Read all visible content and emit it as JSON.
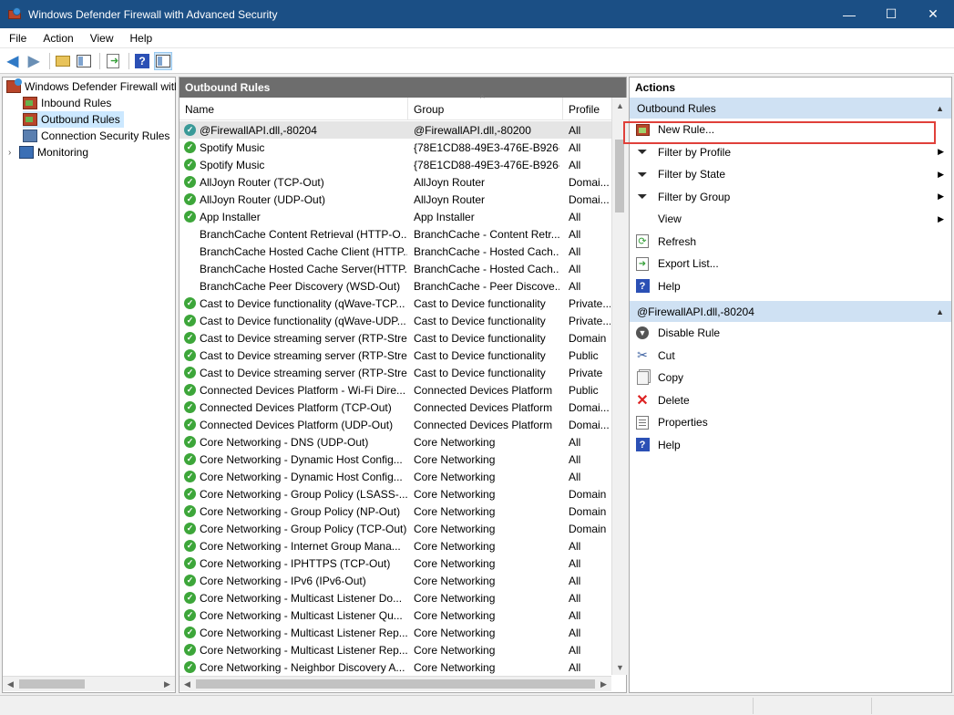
{
  "window": {
    "title": "Windows Defender Firewall with Advanced Security",
    "minimize": "—",
    "maximize": "☐",
    "close": "✕"
  },
  "menu": [
    "File",
    "Action",
    "View",
    "Help"
  ],
  "toolbar": {
    "icons": [
      "back-icon",
      "forward-icon",
      "up-folder-icon",
      "show-hide-console-tree-icon",
      "export-list-icon",
      "help-icon",
      "show-hide-action-pane-icon"
    ]
  },
  "tree": {
    "root": "Windows Defender Firewall witl",
    "items": [
      {
        "label": "Inbound Rules"
      },
      {
        "label": "Outbound Rules"
      },
      {
        "label": "Connection Security Rules"
      },
      {
        "label": "Monitoring"
      }
    ]
  },
  "center": {
    "header": "Outbound Rules",
    "columns": {
      "name": "Name",
      "group": "Group",
      "profile": "Profile"
    },
    "rows": [
      {
        "name": "@FirewallAPI.dll,-80204",
        "group": "@FirewallAPI.dll,-80200",
        "profile": "All",
        "enabled": true,
        "icon": "globe"
      },
      {
        "name": "Spotify Music",
        "group": "{78E1CD88-49E3-476E-B926-...",
        "profile": "All",
        "enabled": true
      },
      {
        "name": "Spotify Music",
        "group": "{78E1CD88-49E3-476E-B926-...",
        "profile": "All",
        "enabled": true
      },
      {
        "name": "AllJoyn Router (TCP-Out)",
        "group": "AllJoyn Router",
        "profile": "Domai...",
        "enabled": true
      },
      {
        "name": "AllJoyn Router (UDP-Out)",
        "group": "AllJoyn Router",
        "profile": "Domai...",
        "enabled": true
      },
      {
        "name": "App Installer",
        "group": "App Installer",
        "profile": "All",
        "enabled": true
      },
      {
        "name": "BranchCache Content Retrieval (HTTP-O...",
        "group": "BranchCache - Content Retr...",
        "profile": "All",
        "enabled": false
      },
      {
        "name": "BranchCache Hosted Cache Client (HTTP...",
        "group": "BranchCache - Hosted Cach...",
        "profile": "All",
        "enabled": false
      },
      {
        "name": "BranchCache Hosted Cache Server(HTTP...",
        "group": "BranchCache - Hosted Cach...",
        "profile": "All",
        "enabled": false
      },
      {
        "name": "BranchCache Peer Discovery (WSD-Out)",
        "group": "BranchCache - Peer Discove...",
        "profile": "All",
        "enabled": false
      },
      {
        "name": "Cast to Device functionality (qWave-TCP...",
        "group": "Cast to Device functionality",
        "profile": "Private...",
        "enabled": true
      },
      {
        "name": "Cast to Device functionality (qWave-UDP...",
        "group": "Cast to Device functionality",
        "profile": "Private...",
        "enabled": true
      },
      {
        "name": "Cast to Device streaming server (RTP-Stre...",
        "group": "Cast to Device functionality",
        "profile": "Domain",
        "enabled": true
      },
      {
        "name": "Cast to Device streaming server (RTP-Stre...",
        "group": "Cast to Device functionality",
        "profile": "Public",
        "enabled": true
      },
      {
        "name": "Cast to Device streaming server (RTP-Stre...",
        "group": "Cast to Device functionality",
        "profile": "Private",
        "enabled": true
      },
      {
        "name": "Connected Devices Platform - Wi-Fi Dire...",
        "group": "Connected Devices Platform",
        "profile": "Public",
        "enabled": true
      },
      {
        "name": "Connected Devices Platform (TCP-Out)",
        "group": "Connected Devices Platform",
        "profile": "Domai...",
        "enabled": true
      },
      {
        "name": "Connected Devices Platform (UDP-Out)",
        "group": "Connected Devices Platform",
        "profile": "Domai...",
        "enabled": true
      },
      {
        "name": "Core Networking - DNS (UDP-Out)",
        "group": "Core Networking",
        "profile": "All",
        "enabled": true
      },
      {
        "name": "Core Networking - Dynamic Host Config...",
        "group": "Core Networking",
        "profile": "All",
        "enabled": true
      },
      {
        "name": "Core Networking - Dynamic Host Config...",
        "group": "Core Networking",
        "profile": "All",
        "enabled": true
      },
      {
        "name": "Core Networking - Group Policy (LSASS-...",
        "group": "Core Networking",
        "profile": "Domain",
        "enabled": true
      },
      {
        "name": "Core Networking - Group Policy (NP-Out)",
        "group": "Core Networking",
        "profile": "Domain",
        "enabled": true
      },
      {
        "name": "Core Networking - Group Policy (TCP-Out)",
        "group": "Core Networking",
        "profile": "Domain",
        "enabled": true
      },
      {
        "name": "Core Networking - Internet Group Mana...",
        "group": "Core Networking",
        "profile": "All",
        "enabled": true
      },
      {
        "name": "Core Networking - IPHTTPS (TCP-Out)",
        "group": "Core Networking",
        "profile": "All",
        "enabled": true
      },
      {
        "name": "Core Networking - IPv6 (IPv6-Out)",
        "group": "Core Networking",
        "profile": "All",
        "enabled": true
      },
      {
        "name": "Core Networking - Multicast Listener Do...",
        "group": "Core Networking",
        "profile": "All",
        "enabled": true
      },
      {
        "name": "Core Networking - Multicast Listener Qu...",
        "group": "Core Networking",
        "profile": "All",
        "enabled": true
      },
      {
        "name": "Core Networking - Multicast Listener Rep...",
        "group": "Core Networking",
        "profile": "All",
        "enabled": true
      },
      {
        "name": "Core Networking - Multicast Listener Rep...",
        "group": "Core Networking",
        "profile": "All",
        "enabled": true
      },
      {
        "name": "Core Networking - Neighbor Discovery A...",
        "group": "Core Networking",
        "profile": "All",
        "enabled": true
      }
    ]
  },
  "actions": {
    "title": "Actions",
    "section1": {
      "label": "Outbound Rules",
      "items": [
        {
          "label": "New Rule...",
          "icon": "new-rule-icon",
          "submenu": false
        },
        {
          "label": "Filter by Profile",
          "icon": "filter-icon",
          "submenu": true
        },
        {
          "label": "Filter by State",
          "icon": "filter-icon",
          "submenu": true
        },
        {
          "label": "Filter by Group",
          "icon": "filter-icon",
          "submenu": true
        },
        {
          "label": "View",
          "icon": "",
          "submenu": true
        },
        {
          "label": "Refresh",
          "icon": "refresh-icon",
          "submenu": false
        },
        {
          "label": "Export List...",
          "icon": "export-icon",
          "submenu": false
        },
        {
          "label": "Help",
          "icon": "help-icon",
          "submenu": false
        }
      ]
    },
    "section2": {
      "label": "@FirewallAPI.dll,-80204",
      "items": [
        {
          "label": "Disable Rule",
          "icon": "disable-rule-icon"
        },
        {
          "label": "Cut",
          "icon": "cut-icon"
        },
        {
          "label": "Copy",
          "icon": "copy-icon"
        },
        {
          "label": "Delete",
          "icon": "delete-icon"
        },
        {
          "label": "Properties",
          "icon": "properties-icon"
        },
        {
          "label": "Help",
          "icon": "help-icon"
        }
      ]
    }
  },
  "highlight_color": "#e0403a"
}
